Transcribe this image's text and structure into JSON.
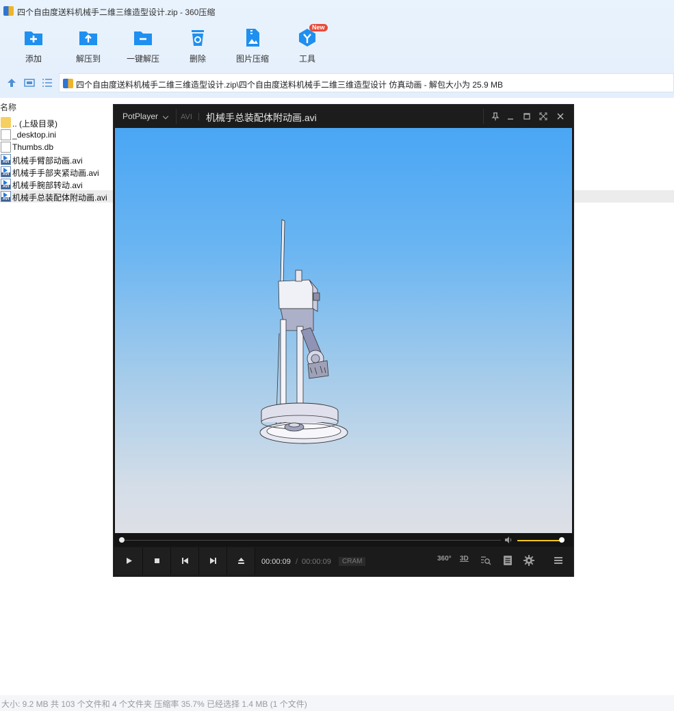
{
  "window": {
    "title": "四个自由度送料机械手二维三维造型设计.zip - 360压缩"
  },
  "toolbar": {
    "items": [
      {
        "label": "添加",
        "icon": "add-icon"
      },
      {
        "label": "解压到",
        "icon": "extract-to-icon"
      },
      {
        "label": "一键解压",
        "icon": "one-click-extract-icon"
      },
      {
        "label": "删除",
        "icon": "delete-icon"
      },
      {
        "label": "图片压缩",
        "icon": "image-compress-icon"
      },
      {
        "label": "工具",
        "icon": "tools-icon",
        "badge": "New"
      }
    ]
  },
  "address": {
    "path": "四个自由度送料机械手二维三维造型设计.zip\\四个自由度送料机械手二维三维造型设计 仿真动画 - 解包大小为 25.9 MB"
  },
  "list": {
    "column_name": "名称",
    "files": [
      {
        "name": ".. (上级目录)",
        "type": "folder"
      },
      {
        "name": "_desktop.ini",
        "type": "file"
      },
      {
        "name": "Thumbs.db",
        "type": "file"
      },
      {
        "name": "机械手臂部动画.avi",
        "type": "avi"
      },
      {
        "name": "机械手手部夹紧动画.avi",
        "type": "avi"
      },
      {
        "name": "机械手腕部转动.avi",
        "type": "avi"
      },
      {
        "name": "机械手总装配体附动画.avi",
        "type": "avi",
        "selected": true
      }
    ]
  },
  "status": {
    "text": "大小: 9.2 MB 共 103 个文件和 4 个文件夹 压缩率 35.7% 已经选择 1.4 MB (1 个文件)"
  },
  "player": {
    "brand": "PotPlayer",
    "format": "AVI",
    "video_title": "机械手总装配体附动画.avi",
    "time_current": "00:00:09",
    "time_separator": "/",
    "time_total": "00:00:09",
    "codec": "CRAM",
    "btn_360": "360°",
    "btn_3d": "3D",
    "progress": 0.0,
    "volume": 0.95,
    "colors": {
      "accent": "#f5c518",
      "sky_top": "#4aa6f4",
      "sky_bottom": "#dedfe6"
    }
  }
}
